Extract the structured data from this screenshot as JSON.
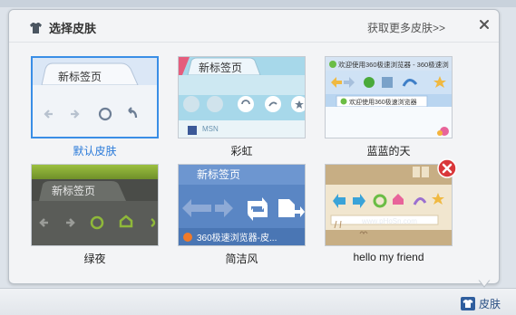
{
  "panel": {
    "title": "选择皮肤",
    "more_link": "获取更多皮肤>>",
    "close_icon": "close-icon"
  },
  "skins": [
    {
      "name": "默认皮肤",
      "selected": true,
      "preview_text": "新标签页"
    },
    {
      "name": "彩虹",
      "selected": false,
      "preview_text": "新标签页",
      "preview_text2": "MSN"
    },
    {
      "name": "蓝蓝的天",
      "selected": false,
      "preview_text": "欢迎使用360极速浏览器 - 360极速浏",
      "preview_text2": "欢迎使用360极速浏览器"
    },
    {
      "name": "绿夜",
      "selected": false,
      "preview_text": "新标签页"
    },
    {
      "name": "简洁风",
      "selected": false,
      "preview_text": "新标签页",
      "preview_text2": "360极速浏览器-皮..."
    },
    {
      "name": "hello my friend",
      "selected": false,
      "preview_text": "www.pHoSn.com"
    }
  ],
  "statusbar": {
    "skin_label": "皮肤"
  },
  "colors": {
    "accent": "#3a8ee6",
    "selected_text": "#2a7ad9"
  }
}
